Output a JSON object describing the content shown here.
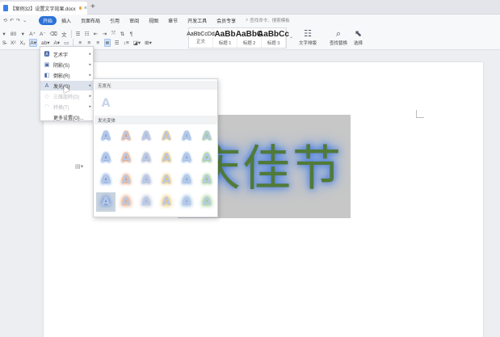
{
  "titlebar": {
    "doc_title": "【案例32】设置文字效果.docx",
    "new_tab": "+",
    "close": "×"
  },
  "quick_access": {
    "save": "⟲",
    "undo": "↶",
    "redo": "↷",
    "more": "⌄"
  },
  "menu": {
    "tabs": [
      "开始",
      "插入",
      "页面布局",
      "引用",
      "审阅",
      "视图",
      "章节",
      "开发工具",
      "会员专享"
    ],
    "active_index": 0,
    "search_placeholder": "查找命令、搜索模板"
  },
  "ribbon": {
    "font_size": "80",
    "grow": "A⁺",
    "shrink": "A⁻",
    "clear": "⌫",
    "pinyin": "文",
    "bullets": "☰",
    "numbering": "☷",
    "indent_dec": "⇤",
    "indent_inc": "⇥",
    "styles": [
      {
        "sample": "AaBbCcDd",
        "label": "正文",
        "big": false
      },
      {
        "sample": "AaBb",
        "label": "标题 1",
        "big": true
      },
      {
        "sample": "AaBbC",
        "label": "标题 2",
        "big": true
      },
      {
        "sample": "AaBbCc",
        "label": "标题 3",
        "big": true
      }
    ],
    "text_layout": "文字排版",
    "find_replace": "查找替换",
    "select": "选择"
  },
  "effects_menu": {
    "items": [
      {
        "icon": "🅰",
        "label": "艺术字",
        "arrow": true,
        "selected": false,
        "disabled": false
      },
      {
        "icon": "▣",
        "label": "阴影(S)",
        "arrow": true,
        "selected": false,
        "disabled": false
      },
      {
        "icon": "◧",
        "label": "倒影(R)",
        "arrow": true,
        "selected": false,
        "disabled": false
      },
      {
        "icon": "A",
        "label": "发光(G)",
        "arrow": true,
        "selected": true,
        "disabled": false
      },
      {
        "icon": "◇",
        "label": "三维旋转(D)",
        "arrow": true,
        "selected": false,
        "disabled": true
      },
      {
        "icon": "◠",
        "label": "转换(T)",
        "arrow": true,
        "selected": false,
        "disabled": true
      },
      {
        "icon": "",
        "label": "更多设置(O)...",
        "arrow": false,
        "selected": false,
        "disabled": false
      }
    ]
  },
  "glow_flyout": {
    "no_glow_header": "无发光",
    "variants_header": "发光变体",
    "glyph": "A",
    "colors": [
      "#5b8fd9",
      "#e2874e",
      "#9aa7c4",
      "#e8b84a",
      "#6ea0d8",
      "#7bbd6a"
    ],
    "rows": 4,
    "active_cell": [
      3,
      0
    ]
  },
  "document": {
    "display_text": "庆佳节",
    "glow_color": "#3f73d8"
  }
}
